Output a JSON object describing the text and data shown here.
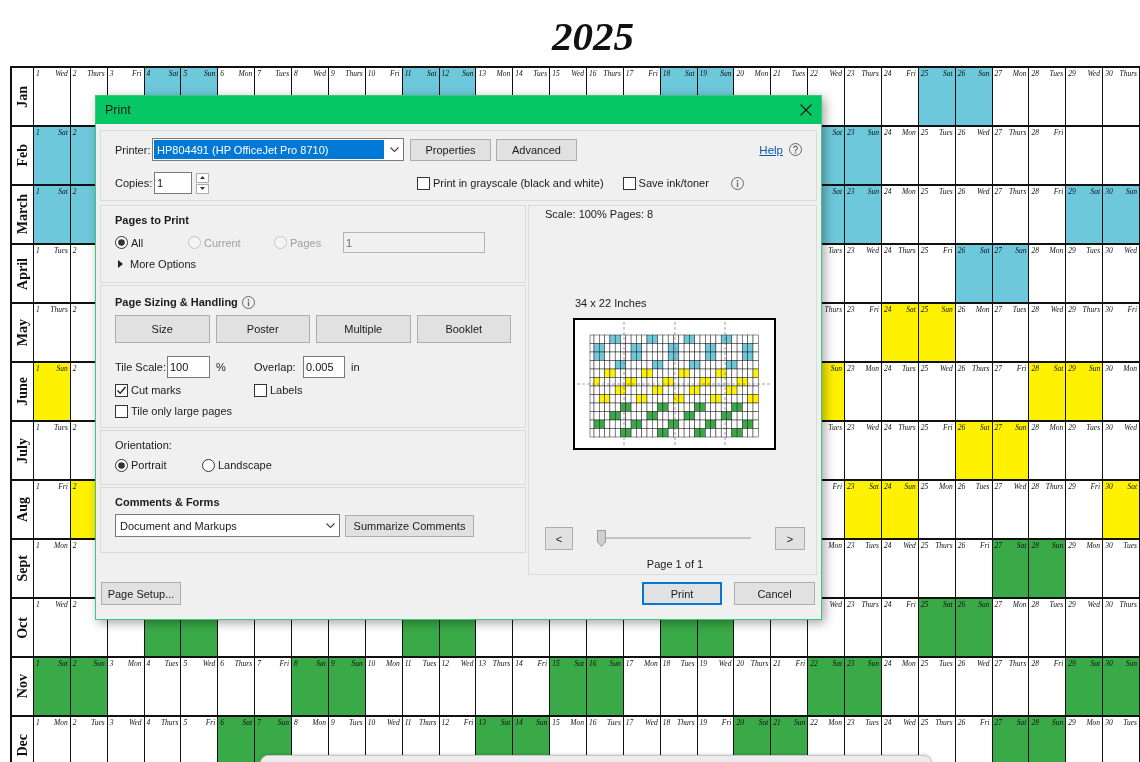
{
  "title": "2025",
  "calendar": {
    "months": [
      {
        "label": "Jan",
        "color": "#6ec8dc",
        "cells": [
          {
            "day": "1",
            "weekday": "Wed",
            "weekend": false
          },
          {
            "day": "2",
            "weekday": "Thurs",
            "weekend": false
          },
          {
            "day": "3",
            "weekday": "Fri",
            "weekend": false
          },
          {
            "day": "4",
            "weekday": "Sat",
            "weekend": true
          },
          {
            "day": "5",
            "weekday": "Sun",
            "weekend": true
          },
          {
            "day": "6",
            "weekday": "Mon",
            "weekend": false
          },
          {
            "day": "7",
            "weekday": "Tues",
            "weekend": false
          },
          {
            "day": "8",
            "weekday": "Wed",
            "weekend": false
          },
          {
            "day": "9",
            "weekday": "Thurs",
            "weekend": false
          },
          {
            "day": "10",
            "weekday": "Fri",
            "weekend": false
          },
          {
            "day": "11",
            "weekday": "Sat",
            "weekend": true
          },
          {
            "day": "12",
            "weekday": "Sun",
            "weekend": true
          },
          {
            "day": "13",
            "weekday": "Mon",
            "weekend": false
          },
          {
            "day": "14",
            "weekday": "Tues",
            "weekend": false
          },
          {
            "day": "15",
            "weekday": "Wed",
            "weekend": false
          },
          {
            "day": "16",
            "weekday": "Thurs",
            "weekend": false
          },
          {
            "day": "17",
            "weekday": "Fri",
            "weekend": false
          },
          {
            "day": "18",
            "weekday": "Sat",
            "weekend": true
          },
          {
            "day": "19",
            "weekday": "Sun",
            "weekend": true
          },
          {
            "day": "20",
            "weekday": "Mon",
            "weekend": false
          },
          {
            "day": "21",
            "weekday": "Tues",
            "weekend": false
          },
          {
            "day": "22",
            "weekday": "Wed",
            "weekend": false
          },
          {
            "day": "23",
            "weekday": "Thurs",
            "weekend": false
          },
          {
            "day": "24",
            "weekday": "Fri",
            "weekend": false
          },
          {
            "day": "25",
            "weekday": "Sat",
            "weekend": true
          },
          {
            "day": "26",
            "weekday": "Sun",
            "weekend": true
          },
          {
            "day": "27",
            "weekday": "Mon",
            "weekend": false
          },
          {
            "day": "28",
            "weekday": "Tues",
            "weekend": false
          },
          {
            "day": "29",
            "weekday": "Wed",
            "weekend": false
          },
          {
            "day": "30",
            "weekday": "Thurs",
            "weekend": false
          }
        ]
      },
      {
        "label": "Feb",
        "color": "#6ec8dc",
        "cells": [
          {
            "day": "1",
            "weekday": "Sat",
            "weekend": true
          },
          {
            "day": "2",
            "weekend": true
          }
        ],
        "tail_cells": [
          {
            "weekday": "Sat",
            "weekend": true
          },
          {
            "day": "23",
            "weekday": "Sun",
            "weekend": true
          },
          {
            "day": "24",
            "weekday": "Mon",
            "weekend": false
          },
          {
            "day": "25",
            "weekday": "Tues",
            "weekend": false
          },
          {
            "day": "26",
            "weekday": "Wed",
            "weekend": false
          },
          {
            "day": "27",
            "weekday": "Thurs",
            "weekend": false
          },
          {
            "day": "28",
            "weekday": "Fri",
            "weekend": false
          }
        ]
      },
      {
        "label": "March",
        "color": "#6ec8dc",
        "cells": [
          {
            "day": "1",
            "weekday": "Sat",
            "weekend": true
          },
          {
            "day": "2",
            "weekend": true
          }
        ],
        "tail_cells": [
          {
            "weekday": "Sat",
            "weekend": true
          },
          {
            "day": "23",
            "weekday": "Sun",
            "weekend": true
          },
          {
            "day": "24",
            "weekday": "Mon",
            "weekend": false
          },
          {
            "day": "25",
            "weekday": "Tues",
            "weekend": false
          },
          {
            "day": "26",
            "weekday": "Wed",
            "weekend": false
          },
          {
            "day": "27",
            "weekday": "Thurs",
            "weekend": false
          },
          {
            "day": "28",
            "weekday": "Fri",
            "weekend": false
          },
          {
            "day": "29",
            "weekday": "Sat",
            "weekend": true
          },
          {
            "day": "30",
            "weekday": "Sun",
            "weekend": true
          }
        ]
      },
      {
        "label": "April",
        "color": "#6ec8dc",
        "cells": [
          {
            "day": "1",
            "weekday": "Tues",
            "weekend": false
          },
          {
            "day": "2",
            "weekend": false
          }
        ],
        "tail_cells": [
          {
            "weekday": "Tues",
            "weekend": false
          },
          {
            "day": "23",
            "weekday": "Wed",
            "weekend": false
          },
          {
            "day": "24",
            "weekday": "Thurs",
            "weekend": false
          },
          {
            "day": "25",
            "weekday": "Fri",
            "weekend": false
          },
          {
            "day": "26",
            "weekday": "Sat",
            "weekend": true
          },
          {
            "day": "27",
            "weekday": "Sun",
            "weekend": true
          },
          {
            "day": "28",
            "weekday": "Mon",
            "weekend": false
          },
          {
            "day": "29",
            "weekday": "Tues",
            "weekend": false
          },
          {
            "day": "30",
            "weekday": "Wed",
            "weekend": false
          }
        ]
      },
      {
        "label": "May",
        "color": "#fff200",
        "cells": [
          {
            "day": "1",
            "weekday": "Thurs",
            "weekend": false
          },
          {
            "day": "2",
            "weekend": false
          }
        ],
        "tail_cells": [
          {
            "weekday": "Thurs",
            "weekend": false
          },
          {
            "day": "23",
            "weekday": "Fri",
            "weekend": false
          },
          {
            "day": "24",
            "weekday": "Sat",
            "weekend": true
          },
          {
            "day": "25",
            "weekday": "Sun",
            "weekend": true
          },
          {
            "day": "26",
            "weekday": "Mon",
            "weekend": false
          },
          {
            "day": "27",
            "weekday": "Tues",
            "weekend": false
          },
          {
            "day": "28",
            "weekday": "Wed",
            "weekend": false
          },
          {
            "day": "29",
            "weekday": "Thurs",
            "weekend": false
          },
          {
            "day": "30",
            "weekday": "Fri",
            "weekend": false
          }
        ]
      },
      {
        "label": "June",
        "color": "#fff200",
        "cells": [
          {
            "day": "1",
            "weekday": "Sun",
            "weekend": true
          },
          {
            "day": "2",
            "weekend": false
          }
        ],
        "tail_cells": [
          {
            "weekday": "Sun",
            "weekend": true
          },
          {
            "day": "23",
            "weekday": "Mon",
            "weekend": false
          },
          {
            "day": "24",
            "weekday": "Tues",
            "weekend": false
          },
          {
            "day": "25",
            "weekday": "Wed",
            "weekend": false
          },
          {
            "day": "26",
            "weekday": "Thurs",
            "weekend": false
          },
          {
            "day": "27",
            "weekday": "Fri",
            "weekend": false
          },
          {
            "day": "28",
            "weekday": "Sat",
            "weekend": true
          },
          {
            "day": "29",
            "weekday": "Sun",
            "weekend": true
          },
          {
            "day": "30",
            "weekday": "Mon",
            "weekend": false
          }
        ]
      },
      {
        "label": "July",
        "color": "#fff200",
        "cells": [
          {
            "day": "1",
            "weekday": "Tues",
            "weekend": false
          },
          {
            "day": "2",
            "weekend": false
          }
        ],
        "tail_cells": [
          {
            "weekday": "Tues",
            "weekend": false
          },
          {
            "day": "23",
            "weekday": "Wed",
            "weekend": false
          },
          {
            "day": "24",
            "weekday": "Thurs",
            "weekend": false
          },
          {
            "day": "25",
            "weekday": "Fri",
            "weekend": false
          },
          {
            "day": "26",
            "weekday": "Sat",
            "weekend": true
          },
          {
            "day": "27",
            "weekday": "Sun",
            "weekend": true
          },
          {
            "day": "28",
            "weekday": "Mon",
            "weekend": false
          },
          {
            "day": "29",
            "weekday": "Tues",
            "weekend": false
          },
          {
            "day": "30",
            "weekday": "Wed",
            "weekend": false
          }
        ]
      },
      {
        "label": "Aug",
        "color": "#fff200",
        "cells": [
          {
            "day": "1",
            "weekday": "Fri",
            "weekend": false
          },
          {
            "day": "2",
            "weekend": true
          }
        ],
        "tail_cells": [
          {
            "weekday": "Fri",
            "weekend": false
          },
          {
            "day": "23",
            "weekday": "Sat",
            "weekend": true
          },
          {
            "day": "24",
            "weekday": "Sun",
            "weekend": true
          },
          {
            "day": "25",
            "weekday": "Mon",
            "weekend": false
          },
          {
            "day": "26",
            "weekday": "Tues",
            "weekend": false
          },
          {
            "day": "27",
            "weekday": "Wed",
            "weekend": false
          },
          {
            "day": "28",
            "weekday": "Thurs",
            "weekend": false
          },
          {
            "day": "29",
            "weekday": "Fri",
            "weekend": false
          },
          {
            "day": "30",
            "weekday": "Sat",
            "weekend": true
          }
        ]
      },
      {
        "label": "Sept",
        "color": "#3aaa48",
        "cells": [
          {
            "day": "1",
            "weekday": "Mon",
            "weekend": false
          },
          {
            "day": "2",
            "weekend": false
          }
        ],
        "tail_cells": [
          {
            "weekday": "Mon",
            "weekend": false
          },
          {
            "day": "23",
            "weekday": "Tues",
            "weekend": false
          },
          {
            "day": "24",
            "weekday": "Wed",
            "weekend": false
          },
          {
            "day": "25",
            "weekday": "Thurs",
            "weekend": false
          },
          {
            "day": "26",
            "weekday": "Fri",
            "weekend": false
          },
          {
            "day": "27",
            "weekday": "Sat",
            "weekend": true
          },
          {
            "day": "28",
            "weekday": "Sun",
            "weekend": true
          },
          {
            "day": "29",
            "weekday": "Mon",
            "weekend": false
          },
          {
            "day": "30",
            "weekday": "Tues",
            "weekend": false
          }
        ]
      },
      {
        "label": "Oct",
        "color": "#3aaa48",
        "cells": [
          {
            "day": "1",
            "weekday": "Wed",
            "weekend": false
          },
          {
            "day": "2",
            "weekend": false
          },
          {
            "weekend": false
          },
          {
            "weekend": true
          },
          {
            "weekend": true
          },
          {
            "weekend": false
          },
          {
            "weekend": false
          },
          {
            "weekend": false
          },
          {
            "weekend": false
          },
          {
            "weekend": false
          },
          {
            "weekend": true
          },
          {
            "weekend": true
          },
          {
            "weekend": false
          },
          {
            "weekend": false
          },
          {
            "weekend": false
          },
          {
            "weekend": false
          },
          {
            "weekend": false
          },
          {
            "weekend": true
          },
          {
            "weekend": true
          },
          {
            "weekend": false
          },
          {
            "weekend": false
          },
          {
            "weekday": "Wed",
            "weekend": false
          },
          {
            "day": "23",
            "weekday": "Thurs",
            "weekend": false
          },
          {
            "day": "24",
            "weekday": "Fri",
            "weekend": false
          },
          {
            "day": "25",
            "weekday": "Sat",
            "weekend": true
          },
          {
            "day": "26",
            "weekday": "Sun",
            "weekend": true
          },
          {
            "day": "27",
            "weekday": "Mon",
            "weekend": false
          },
          {
            "day": "28",
            "weekday": "Tues",
            "weekend": false
          },
          {
            "day": "29",
            "weekday": "Wed",
            "weekend": false
          },
          {
            "day": "30",
            "weekday": "Thurs",
            "weekend": false
          }
        ]
      },
      {
        "label": "Nov",
        "color": "#3aaa48",
        "cells": [
          {
            "day": "1",
            "weekday": "Sat",
            "weekend": true
          },
          {
            "day": "2",
            "weekday": "Sun",
            "weekend": true
          },
          {
            "day": "3",
            "weekday": "Mon",
            "weekend": false
          },
          {
            "day": "4",
            "weekday": "Tues",
            "weekend": false
          },
          {
            "day": "5",
            "weekday": "Wed",
            "weekend": false
          },
          {
            "day": "6",
            "weekday": "Thurs",
            "weekend": false
          },
          {
            "day": "7",
            "weekday": "Fri",
            "weekend": false
          },
          {
            "day": "8",
            "weekday": "Sat",
            "weekend": true
          },
          {
            "day": "9",
            "weekday": "Sun",
            "weekend": true
          },
          {
            "day": "10",
            "weekday": "Mon",
            "weekend": false
          },
          {
            "day": "11",
            "weekday": "Tues",
            "weekend": false
          },
          {
            "day": "12",
            "weekday": "Wed",
            "weekend": false
          },
          {
            "day": "13",
            "weekday": "Thurs",
            "weekend": false
          },
          {
            "day": "14",
            "weekday": "Fri",
            "weekend": false
          },
          {
            "day": "15",
            "weekday": "Sat",
            "weekend": true
          },
          {
            "day": "16",
            "weekday": "Sun",
            "weekend": true
          },
          {
            "day": "17",
            "weekday": "Mon",
            "weekend": false
          },
          {
            "day": "18",
            "weekday": "Tues",
            "weekend": false
          },
          {
            "day": "19",
            "weekday": "Wed",
            "weekend": false
          },
          {
            "day": "20",
            "weekday": "Thurs",
            "weekend": false
          },
          {
            "day": "21",
            "weekday": "Fri",
            "weekend": false
          },
          {
            "day": "22",
            "weekday": "Sat",
            "weekend": true
          },
          {
            "day": "23",
            "weekday": "Sun",
            "weekend": true
          },
          {
            "day": "24",
            "weekday": "Mon",
            "weekend": false
          },
          {
            "day": "25",
            "weekday": "Tues",
            "weekend": false
          },
          {
            "day": "26",
            "weekday": "Wed",
            "weekend": false
          },
          {
            "day": "27",
            "weekday": "Thurs",
            "weekend": false
          },
          {
            "day": "28",
            "weekday": "Fri",
            "weekend": false
          },
          {
            "day": "29",
            "weekday": "Sat",
            "weekend": true
          },
          {
            "day": "30",
            "weekday": "Sun",
            "weekend": true
          }
        ]
      },
      {
        "label": "Dec",
        "color": "#3aaa48",
        "cells": [
          {
            "day": "1",
            "weekday": "Mon",
            "weekend": false
          },
          {
            "day": "2",
            "weekday": "Tues",
            "weekend": false
          },
          {
            "day": "3",
            "weekday": "Wed",
            "weekend": false
          },
          {
            "day": "4",
            "weekday": "Thurs",
            "weekend": false
          },
          {
            "day": "5",
            "weekday": "Fri",
            "weekend": false
          },
          {
            "day": "6",
            "weekday": "Sat",
            "weekend": true
          },
          {
            "day": "7",
            "weekday": "Sun",
            "weekend": true
          },
          {
            "day": "8",
            "weekday": "Mon",
            "weekend": false
          },
          {
            "day": "9",
            "weekday": "Tues",
            "weekend": false
          },
          {
            "day": "10",
            "weekday": "Wed",
            "weekend": false
          },
          {
            "day": "11",
            "weekday": "Thurs",
            "weekend": false
          },
          {
            "day": "12",
            "weekday": "Fri",
            "weekend": false
          },
          {
            "day": "13",
            "weekday": "Sat",
            "weekend": true
          },
          {
            "day": "14",
            "weekday": "Sun",
            "weekend": true
          },
          {
            "day": "15",
            "weekday": "Mon",
            "weekend": false
          },
          {
            "day": "16",
            "weekday": "Tues",
            "weekend": false
          },
          {
            "day": "17",
            "weekday": "Wed",
            "weekend": false
          },
          {
            "day": "18",
            "weekday": "Thurs",
            "weekend": false
          },
          {
            "day": "19",
            "weekday": "Fri",
            "weekend": false
          },
          {
            "day": "20",
            "weekday": "Sat",
            "weekend": true
          },
          {
            "day": "21",
            "weekday": "Sun",
            "weekend": true
          },
          {
            "day": "22",
            "weekday": "Mon",
            "weekend": false
          },
          {
            "day": "23",
            "weekday": "Tues",
            "weekend": false
          },
          {
            "day": "24",
            "weekday": "Wed",
            "weekend": false
          },
          {
            "day": "25",
            "weekday": "Thurs",
            "weekend": false
          },
          {
            "day": "26",
            "weekday": "Fri",
            "weekend": false
          },
          {
            "day": "27",
            "weekday": "Sat",
            "weekend": true
          },
          {
            "day": "28",
            "weekday": "Sun",
            "weekend": true
          },
          {
            "day": "29",
            "weekday": "Mon",
            "weekend": false
          },
          {
            "day": "30",
            "weekday": "Tues",
            "weekend": false
          }
        ]
      }
    ]
  },
  "dialog": {
    "title": "Print",
    "printer": {
      "label": "Printer:",
      "value": "HP804491 (HP OfficeJet Pro 8710)",
      "text_selected": true
    },
    "printer_buttons": [
      "Properties",
      "Advanced"
    ],
    "help": "Help",
    "copies": {
      "label": "Copies:",
      "value": "1"
    },
    "print_options": [
      {
        "label": "Print in grayscale (black and white)",
        "checked": false
      },
      {
        "label": "Save ink/toner",
        "checked": false
      }
    ],
    "pages_to_print": {
      "heading": "Pages to Print",
      "choices": [
        {
          "label": "All",
          "selected": true,
          "disabled": false
        },
        {
          "label": "Current",
          "selected": false,
          "disabled": true
        },
        {
          "label": "Pages",
          "selected": false,
          "disabled": true
        }
      ],
      "pages_field": {
        "value": "1",
        "disabled": true
      },
      "more_options": {
        "label": "More Options",
        "expanded": false
      }
    },
    "page_sizing": {
      "heading": "Page Sizing & Handling",
      "modes": [
        "Size",
        "Poster",
        "Multiple",
        "Booklet"
      ],
      "tile_scale": {
        "label": "Tile Scale:",
        "value": "100",
        "unit": "%"
      },
      "overlap": {
        "label": "Overlap:",
        "value": "0.005",
        "unit": "in"
      },
      "options": [
        {
          "label": "Cut marks",
          "checked": true
        },
        {
          "label": "Labels",
          "checked": false
        },
        {
          "label": "Tile only large pages",
          "checked": false
        }
      ]
    },
    "orientation": {
      "heading": "Orientation:",
      "choices": [
        {
          "label": "Portrait",
          "selected": true
        },
        {
          "label": "Landscape",
          "selected": false
        }
      ]
    },
    "comments_forms": {
      "heading": "Comments & Forms",
      "value": "Document and Markups",
      "button": "Summarize Comments"
    },
    "preview": {
      "summary": "Scale: 100% Pages: 8",
      "paper_size": "34 x 22 Inches",
      "prev": "<",
      "next": ">",
      "level": 0,
      "page_label": "Page 1 of 1"
    },
    "footer_buttons": [
      {
        "label": "Page Setup...",
        "default": false
      },
      {
        "label": "Print",
        "default": true
      },
      {
        "label": "Cancel",
        "default": false
      }
    ]
  }
}
